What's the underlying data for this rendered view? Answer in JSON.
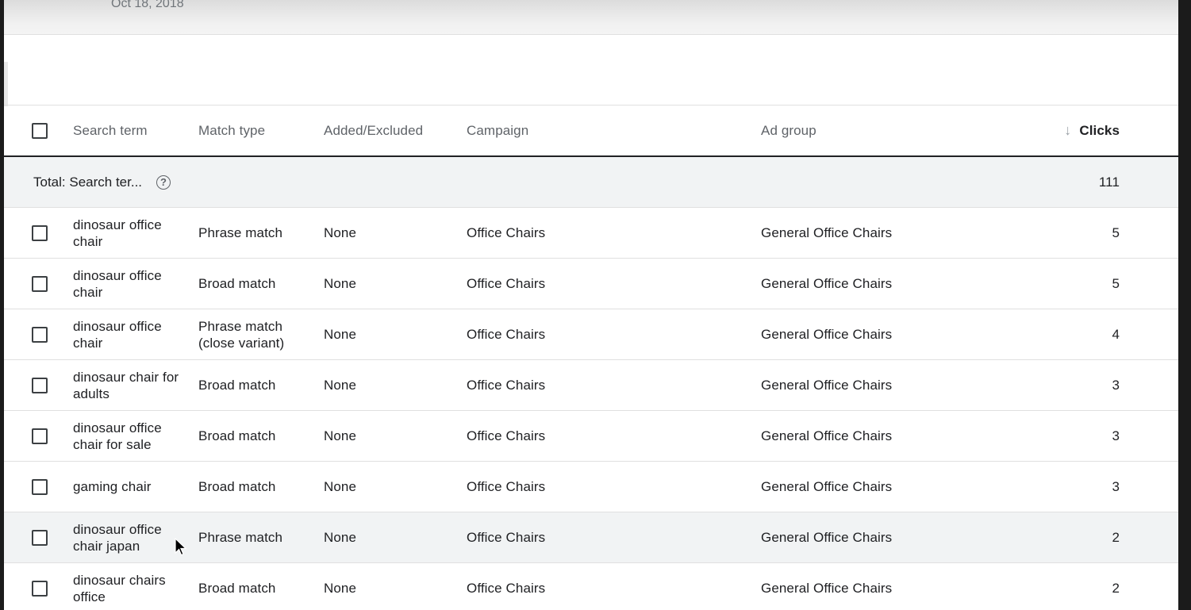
{
  "banner": {
    "date": "Oct 18, 2018"
  },
  "table": {
    "headers": {
      "search_term": "Search term",
      "match_type": "Match type",
      "added_excluded": "Added/Excluded",
      "campaign": "Campaign",
      "ad_group": "Ad group",
      "clicks": "Clicks"
    },
    "sort_icon": "arrow-down-icon",
    "total": {
      "label": "Total: Search ter...",
      "help_icon": "?",
      "clicks": "111"
    },
    "rows": [
      {
        "search_term": "dinosaur office chair",
        "match_type": "Phrase match",
        "added_excluded": "None",
        "campaign": "Office Chairs",
        "ad_group": "General Office Chairs",
        "clicks": "5"
      },
      {
        "search_term": "dinosaur office chair",
        "match_type": "Broad match",
        "added_excluded": "None",
        "campaign": "Office Chairs",
        "ad_group": "General Office Chairs",
        "clicks": "5"
      },
      {
        "search_term": "dinosaur office chair",
        "match_type": "Phrase match (close variant)",
        "added_excluded": "None",
        "campaign": "Office Chairs",
        "ad_group": "General Office Chairs",
        "clicks": "4"
      },
      {
        "search_term": "dinosaur chair for adults",
        "match_type": "Broad match",
        "added_excluded": "None",
        "campaign": "Office Chairs",
        "ad_group": "General Office Chairs",
        "clicks": "3"
      },
      {
        "search_term": "dinosaur office chair for sale",
        "match_type": "Broad match",
        "added_excluded": "None",
        "campaign": "Office Chairs",
        "ad_group": "General Office Chairs",
        "clicks": "3"
      },
      {
        "search_term": "gaming chair",
        "match_type": "Broad match",
        "added_excluded": "None",
        "campaign": "Office Chairs",
        "ad_group": "General Office Chairs",
        "clicks": "3"
      },
      {
        "search_term": "dinosaur office chair japan",
        "match_type": "Phrase match",
        "added_excluded": "None",
        "campaign": "Office Chairs",
        "ad_group": "General Office Chairs",
        "clicks": "2"
      },
      {
        "search_term": "dinosaur chairs office",
        "match_type": "Broad match",
        "added_excluded": "None",
        "campaign": "Office Chairs",
        "ad_group": "General Office Chairs",
        "clicks": "2"
      }
    ]
  },
  "colors": {
    "link": "#1a73e8",
    "hover_row": "#f1f3f4",
    "header_text": "#5f6368"
  }
}
